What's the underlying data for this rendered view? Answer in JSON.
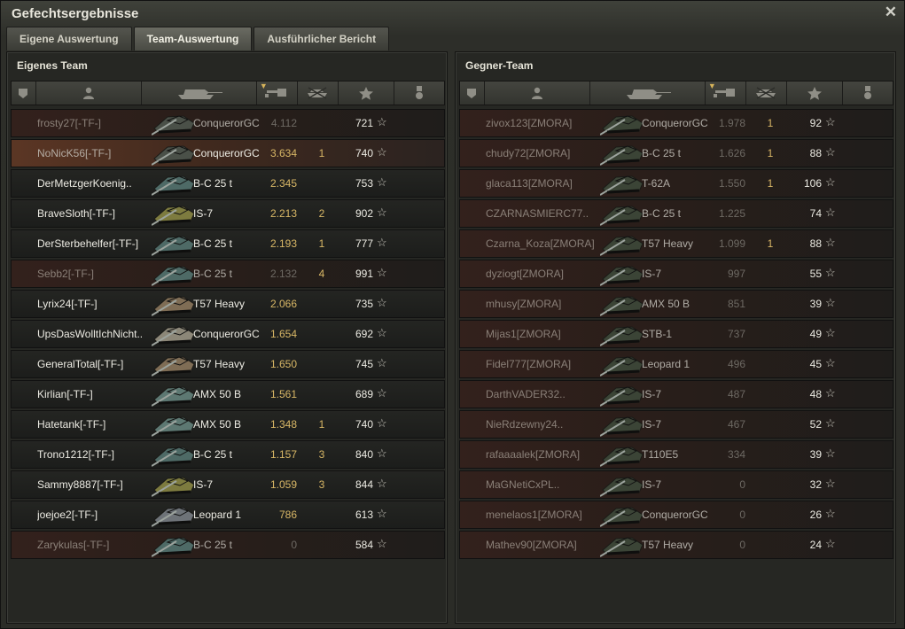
{
  "window": {
    "title": "Gefechtsergebnisse",
    "close_glyph": "✕"
  },
  "tabs": [
    {
      "label": "Eigene Auswertung",
      "active": false
    },
    {
      "label": "Team-Auswertung",
      "active": true
    },
    {
      "label": "Ausführlicher Bericht",
      "active": false
    }
  ],
  "header_icons": [
    "rank-shield-icon",
    "player-icon",
    "tank-icon",
    "damage-gun-icon",
    "destroyed-tank-icon",
    "xp-star-icon",
    "medal-icon"
  ],
  "colors": {
    "accent_gold": "#d8b766",
    "dead_row": "#33211c",
    "self_row": "#5b3624",
    "enemy_tank": "#3b4436"
  },
  "own_team": {
    "title": "Eigenes Team",
    "rows": [
      {
        "player": "frosty27[-TF-]",
        "vehicle": "ConquerorGC",
        "damage": "4.112",
        "kills": "",
        "xp": "721",
        "state": "dead",
        "tank_color": "#4a5048"
      },
      {
        "player": "NoNicK56[-TF-]",
        "vehicle": "ConquerorGC",
        "damage": "3.634",
        "kills": "1",
        "xp": "740",
        "state": "self",
        "tank_color": "#4a5048"
      },
      {
        "player": "DerMetzgerKoenig..",
        "vehicle": "B-C 25 t",
        "damage": "2.345",
        "kills": "",
        "xp": "753",
        "state": "alive",
        "tank_color": "#4e6a66"
      },
      {
        "player": "BraveSloth[-TF-]",
        "vehicle": "IS-7",
        "damage": "2.213",
        "kills": "2",
        "xp": "902",
        "state": "alive",
        "tank_color": "#7d7b3f"
      },
      {
        "player": "DerSterbehelfer[-TF-]",
        "vehicle": "B-C 25 t",
        "damage": "2.193",
        "kills": "1",
        "xp": "777",
        "state": "alive",
        "tank_color": "#4e6a66"
      },
      {
        "player": "Sebb2[-TF-]",
        "vehicle": "B-C 25 t",
        "damage": "2.132",
        "kills": "4",
        "xp": "991",
        "state": "dead",
        "tank_color": "#4e6a66"
      },
      {
        "player": "Lyrix24[-TF-]",
        "vehicle": "T57 Heavy",
        "damage": "2.066",
        "kills": "",
        "xp": "735",
        "state": "alive",
        "tank_color": "#7f6d55"
      },
      {
        "player": "UpsDasWolltIchNicht..",
        "vehicle": "ConquerorGC",
        "damage": "1.654",
        "kills": "",
        "xp": "692",
        "state": "alive",
        "tank_color": "#8c8778"
      },
      {
        "player": "GeneralTotal[-TF-]",
        "vehicle": "T57 Heavy",
        "damage": "1.650",
        "kills": "",
        "xp": "745",
        "state": "alive",
        "tank_color": "#7f6d55"
      },
      {
        "player": "Kirlian[-TF-]",
        "vehicle": "AMX 50 B",
        "damage": "1.561",
        "kills": "",
        "xp": "689",
        "state": "alive",
        "tank_color": "#5d7872"
      },
      {
        "player": "Hatetank[-TF-]",
        "vehicle": "AMX 50 B",
        "damage": "1.348",
        "kills": "1",
        "xp": "740",
        "state": "alive",
        "tank_color": "#5d7872"
      },
      {
        "player": "Trono1212[-TF-]",
        "vehicle": "B-C 25 t",
        "damage": "1.157",
        "kills": "3",
        "xp": "840",
        "state": "alive",
        "tank_color": "#4e6a66"
      },
      {
        "player": "Sammy8887[-TF-]",
        "vehicle": "IS-7",
        "damage": "1.059",
        "kills": "3",
        "xp": "844",
        "state": "alive",
        "tank_color": "#7d7b3f"
      },
      {
        "player": "joejoe2[-TF-]",
        "vehicle": "Leopard 1",
        "damage": "786",
        "kills": "",
        "xp": "613",
        "state": "alive",
        "tank_color": "#6e7378"
      },
      {
        "player": "Zarykulas[-TF-]",
        "vehicle": "B-C 25 t",
        "damage": "0",
        "kills": "",
        "xp": "584",
        "state": "dead",
        "tank_color": "#4e6a66"
      }
    ]
  },
  "enemy_team": {
    "title": "Gegner-Team",
    "rows": [
      {
        "player": "zivox123[ZMORA]",
        "vehicle": "ConquerorGC",
        "damage": "1.978",
        "kills": "1",
        "xp": "92",
        "state": "dead",
        "tank_color": "#3b4436"
      },
      {
        "player": "chudy72[ZMORA]",
        "vehicle": "B-C 25 t",
        "damage": "1.626",
        "kills": "1",
        "xp": "88",
        "state": "dead",
        "tank_color": "#3b4436"
      },
      {
        "player": "glaca113[ZMORA]",
        "vehicle": "T-62A",
        "damage": "1.550",
        "kills": "1",
        "xp": "106",
        "state": "dead",
        "tank_color": "#3b4436"
      },
      {
        "player": "CZARNASMIERC77..",
        "vehicle": "B-C 25 t",
        "damage": "1.225",
        "kills": "",
        "xp": "74",
        "state": "dead",
        "tank_color": "#3b4436"
      },
      {
        "player": "Czarna_Koza[ZMORA]",
        "vehicle": "T57 Heavy",
        "damage": "1.099",
        "kills": "1",
        "xp": "88",
        "state": "dead",
        "tank_color": "#3b4436"
      },
      {
        "player": "dyziogt[ZMORA]",
        "vehicle": "IS-7",
        "damage": "997",
        "kills": "",
        "xp": "55",
        "state": "dead",
        "tank_color": "#3b4436"
      },
      {
        "player": "mhusy[ZMORA]",
        "vehicle": "AMX 50 B",
        "damage": "851",
        "kills": "",
        "xp": "39",
        "state": "dead",
        "tank_color": "#3b4436"
      },
      {
        "player": "Mijas1[ZMORA]",
        "vehicle": "STB-1",
        "damage": "737",
        "kills": "",
        "xp": "49",
        "state": "dead",
        "tank_color": "#3b4436"
      },
      {
        "player": "Fidel777[ZMORA]",
        "vehicle": "Leopard 1",
        "damage": "496",
        "kills": "",
        "xp": "45",
        "state": "dead",
        "tank_color": "#3b4436"
      },
      {
        "player": "DarthVADER32..",
        "vehicle": "IS-7",
        "damage": "487",
        "kills": "",
        "xp": "48",
        "state": "dead",
        "tank_color": "#3b4436"
      },
      {
        "player": "NieRdzewny24..",
        "vehicle": "IS-7",
        "damage": "467",
        "kills": "",
        "xp": "52",
        "state": "dead",
        "tank_color": "#3b4436"
      },
      {
        "player": "rafaaaalek[ZMORA]",
        "vehicle": "T110E5",
        "damage": "334",
        "kills": "",
        "xp": "39",
        "state": "dead",
        "tank_color": "#3b4436"
      },
      {
        "player": "MaGNetiCxPL..",
        "vehicle": "IS-7",
        "damage": "0",
        "kills": "",
        "xp": "32",
        "state": "dead",
        "tank_color": "#3b4436"
      },
      {
        "player": "menelaos1[ZMORA]",
        "vehicle": "ConquerorGC",
        "damage": "0",
        "kills": "",
        "xp": "26",
        "state": "dead",
        "tank_color": "#3b4436"
      },
      {
        "player": "Mathev90[ZMORA]",
        "vehicle": "T57 Heavy",
        "damage": "0",
        "kills": "",
        "xp": "24",
        "state": "dead",
        "tank_color": "#3b4436"
      }
    ]
  }
}
